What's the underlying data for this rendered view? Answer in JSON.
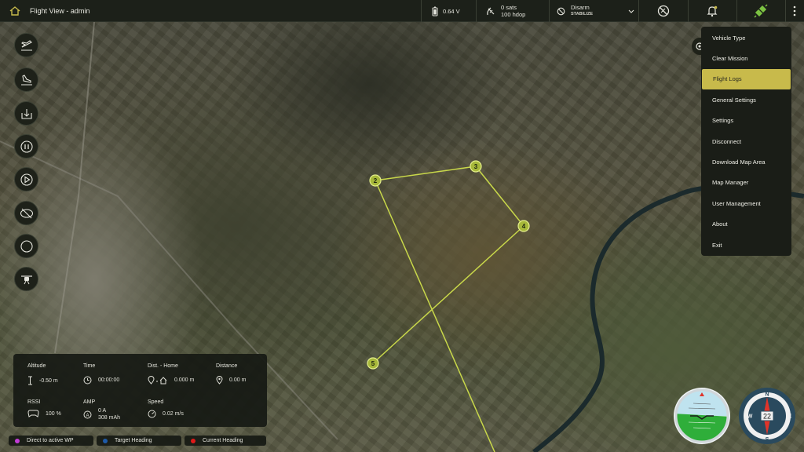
{
  "header": {
    "title": "Flight View - admin",
    "battery": "0.64 V",
    "gps_sats": "0 sats",
    "gps_hdop": "100 hdop",
    "arm_state": "Disarm",
    "flight_mode": "STABILIZE"
  },
  "menu": {
    "items": [
      {
        "label": "Vehicle Type"
      },
      {
        "label": "Clear Mission"
      },
      {
        "label": "Flight Logs"
      },
      {
        "label": "General Settings"
      },
      {
        "label": "Settings"
      },
      {
        "label": "Disconnect"
      },
      {
        "label": "Download Map Area"
      },
      {
        "label": "Map Manager"
      },
      {
        "label": "User Management"
      },
      {
        "label": "About"
      },
      {
        "label": "Exit"
      }
    ],
    "active_index": 2
  },
  "waypoints": [
    "2",
    "3",
    "4",
    "5"
  ],
  "telemetry": {
    "altitude": {
      "label": "Altitude",
      "value": "-0.50 m"
    },
    "time": {
      "label": "Time",
      "value": "00:00:00"
    },
    "dist_home": {
      "label": "Dist. - Home",
      "value": "0.000 m"
    },
    "distance": {
      "label": "Distance",
      "value": "0.00 m"
    },
    "rssi": {
      "label": "RSSI",
      "value": "100 %"
    },
    "amp": {
      "label": "AMP",
      "value_a": "0 A",
      "value_mah": "308 mAh"
    },
    "speed": {
      "label": "Speed",
      "value": "0.02 m/s"
    }
  },
  "legend": {
    "direct": {
      "label": "Direct to active WP",
      "color": "#c23cd6"
    },
    "target": {
      "label": "Target Heading",
      "color": "#1e5aa8"
    },
    "current": {
      "label": "Current Heading",
      "color": "#e01818"
    }
  },
  "compass": {
    "heading": "22",
    "n": "N",
    "s": "S",
    "e": "E",
    "w": "W"
  },
  "colors": {
    "accent": "#c8ba4b",
    "path": "#c9d84a",
    "topbar": "#1c2019"
  }
}
